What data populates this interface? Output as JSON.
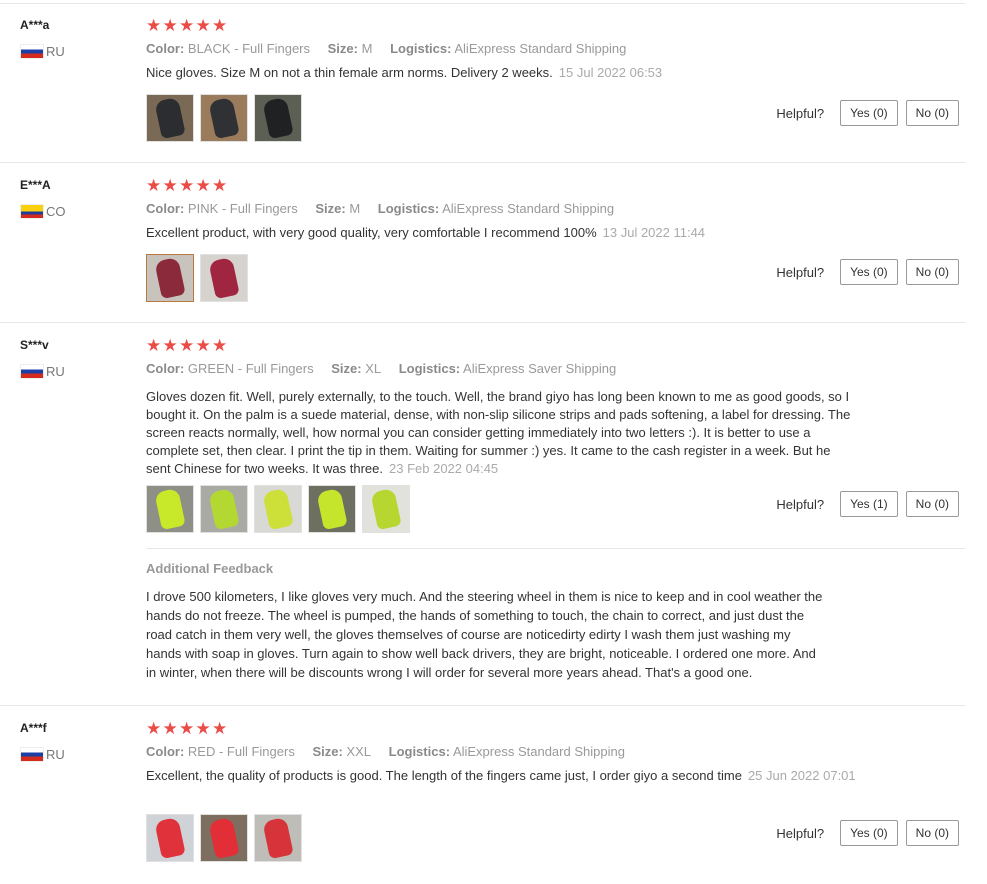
{
  "labels": {
    "color": "Color:",
    "size": "Size:",
    "logistics": "Logistics:",
    "helpful": "Helpful?",
    "additional_feedback": "Additional Feedback"
  },
  "colors": {
    "star": "#ea4c47",
    "thumb_selected_border": "#b9793f"
  },
  "reviews": [
    {
      "user": "A***a",
      "country": "RU",
      "flag": "flag-ru",
      "rating": 5,
      "color": "BLACK - Full Fingers",
      "size": "M",
      "logistics": "AliExpress Standard Shipping",
      "text": "Nice gloves. Size M on not a thin female arm norms. Delivery 2 weeks.",
      "date": "15 Jul 2022 06:53",
      "photos": [
        "black-glove-photo",
        "black-glove-photo",
        "black-glove-photo"
      ],
      "yes": "Yes (0)",
      "no": "No (0)"
    },
    {
      "user": "E***A",
      "country": "CO",
      "flag": "flag-co",
      "rating": 5,
      "color": "PINK - Full Fingers",
      "size": "M",
      "logistics": "AliExpress Standard Shipping",
      "text": "Excellent product, with very good quality, very comfortable I recommend 100%",
      "date": "13 Jul 2022 11:44",
      "photos": [
        "pink-glove-photo",
        "pink-glove-photo"
      ],
      "yes": "Yes (0)",
      "no": "No (0)"
    },
    {
      "user": "S***v",
      "country": "RU",
      "flag": "flag-ru",
      "rating": 5,
      "color": "GREEN - Full Fingers",
      "size": "XL",
      "logistics": "AliExpress Saver Shipping",
      "text": "Gloves dozen fit. Well, purely externally, to the touch. Well, the brand giyo has long been known to me as good goods, so I bought it. On the palm is a suede material, dense, with non-slip silicone strips and pads softening, a label for dressing. The screen reacts normally, well, how normal you can consider getting immediately into two letters :). It is better to use a complete set, then clear. I print the tip in them. Waiting for summer :) yes. It came to the cash register in a week. But he sent Chinese for two weeks. It was three.",
      "date": "23 Feb 2022 04:45",
      "photos": [
        "green-glove-photo",
        "green-glove-photo",
        "green-glove-photo",
        "green-glove-photo",
        "green-glove-photo"
      ],
      "yes": "Yes (1)",
      "no": "No (0)",
      "additional": "I drove 500 kilometers, I like gloves very much. And the steering wheel in them is nice to keep and in cool weather the hands do not freeze. The wheel is pumped, the hands of something to touch, the chain to correct, and just dust the road catch in them very well, the gloves themselves of course are noticedirty edirty I wash them just washing my hands with soap in gloves. Turn again to show well back drivers, they are bright, noticeable. I ordered one more. And in winter, when there will be discounts wrong I will order for several more years ahead. That's a good one."
    },
    {
      "user": "A***f",
      "country": "RU",
      "flag": "flag-ru",
      "rating": 5,
      "color": "RED - Full Fingers",
      "size": "XXL",
      "logistics": "AliExpress Standard Shipping",
      "text": "Excellent, the quality of products is good. The length of the fingers came just, I order giyo a second time",
      "date": "25 Jun 2022 07:01",
      "photos": [
        "red-glove-photo",
        "red-glove-photo",
        "red-glove-photo"
      ],
      "yes": "Yes (0)",
      "no": "No (0)"
    }
  ]
}
